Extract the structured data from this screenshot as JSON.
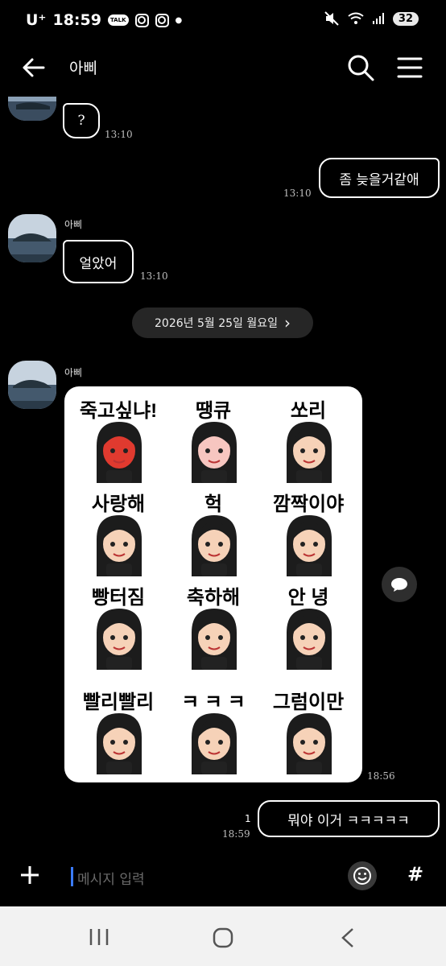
{
  "status": {
    "carrier": "U⁺",
    "time": "18:59",
    "talk_badge": "TALK",
    "battery": "32"
  },
  "header": {
    "title": "아삐"
  },
  "messages": [
    {
      "text": "?",
      "time": "13:10"
    },
    {
      "text": "좀 늦을거같애",
      "time": "13:10"
    },
    {
      "sender": "아삐",
      "text": "얼았어",
      "time": "13:10"
    }
  ],
  "date_divider": {
    "label": "2026년 5월 25일 월요일",
    "chevron": "›"
  },
  "sticker_message": {
    "sender": "아삐",
    "time": "18:56",
    "cells": [
      {
        "label": "죽고싶냐!",
        "color": "#e03a2f"
      },
      {
        "label": "땡큐",
        "color": "#f7c6c0"
      },
      {
        "label": "쏘리",
        "color": "#f6d2b8"
      },
      {
        "label": "사랑해",
        "color": "#f6d2b8"
      },
      {
        "label": "헉",
        "color": "#f6d2b8"
      },
      {
        "label": "깜짝이야",
        "color": "#f6d2b8"
      },
      {
        "label": "빵터짐",
        "color": "#f6d2b8"
      },
      {
        "label": "축하해",
        "color": "#f6d2b8"
      },
      {
        "label": "안  녕",
        "color": "#f6d2b8"
      },
      {
        "label": "빨리빨리",
        "color": "#f6d2b8"
      },
      {
        "label": "ㅋ ㅋ ㅋ",
        "color": "#f6d2b8"
      },
      {
        "label": "그럼이만",
        "color": "#f6d2b8"
      }
    ]
  },
  "my_last_message": {
    "text": "뭐야 이거 ㅋㅋㅋㅋㅋ",
    "time": "18:59",
    "unread": "1"
  },
  "input": {
    "placeholder": "메시지 입력"
  },
  "icons": {
    "back": "back-arrow-icon",
    "search": "search-icon",
    "menu": "menu-icon",
    "share": "share-bubble-icon",
    "plus": "plus-icon",
    "emoji": "emoji-icon",
    "hash": "#"
  },
  "colors": {
    "background": "#000000",
    "bubble_border": "#ffffff",
    "caret": "#3a7bff",
    "navbar": "#f2f2f2"
  }
}
